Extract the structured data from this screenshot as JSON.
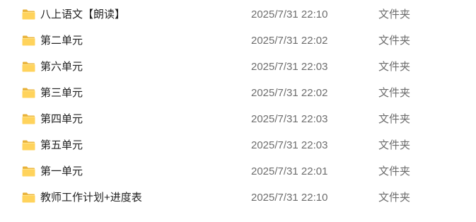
{
  "files": [
    {
      "name": "八上语文【朗读】",
      "modified": "2025/7/31 22:10",
      "type": "文件夹",
      "icon": "folder-icon"
    },
    {
      "name": "第二单元",
      "modified": "2025/7/31 22:02",
      "type": "文件夹",
      "icon": "folder-icon"
    },
    {
      "name": "第六单元",
      "modified": "2025/7/31 22:03",
      "type": "文件夹",
      "icon": "folder-icon"
    },
    {
      "name": "第三单元",
      "modified": "2025/7/31 22:02",
      "type": "文件夹",
      "icon": "folder-icon"
    },
    {
      "name": "第四单元",
      "modified": "2025/7/31 22:03",
      "type": "文件夹",
      "icon": "folder-icon"
    },
    {
      "name": "第五单元",
      "modified": "2025/7/31 22:03",
      "type": "文件夹",
      "icon": "folder-icon"
    },
    {
      "name": "第一单元",
      "modified": "2025/7/31 22:01",
      "type": "文件夹",
      "icon": "folder-icon"
    },
    {
      "name": "教师工作计划+进度表",
      "modified": "2025/7/31 22:10",
      "type": "文件夹",
      "icon": "folder-icon"
    }
  ],
  "colors": {
    "folder_back": "#e8b23a",
    "folder_front": "#ffd35c",
    "name_text": "#222222",
    "meta_text": "#6d6d6d"
  }
}
